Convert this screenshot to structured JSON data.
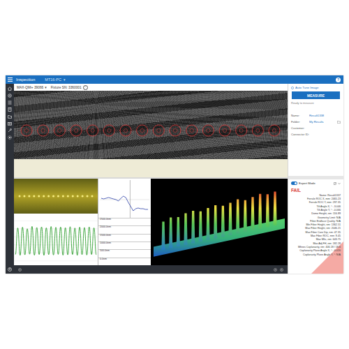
{
  "header": {
    "title": "Inspection",
    "tab": "MT16-PC",
    "tab_arrow": "▾",
    "help": "?"
  },
  "toolbar": {
    "device": "MAX-QMi+ 39066",
    "device_arrow": "▾",
    "fixture": "Fixture SN: 3360001",
    "info": "i"
  },
  "side": {
    "auto_tune": "Auto Tune Image",
    "measure": "MEASURE",
    "ready": "Ready to measure",
    "fields": [
      {
        "label": "Name:",
        "value": "Result1338",
        "kind": "link"
      },
      {
        "label": "Folder:",
        "value": "My Results",
        "kind": "folder"
      },
      {
        "label": "Customer:",
        "kind": "text"
      },
      {
        "label": "Connector ID:",
        "kind": "text"
      }
    ]
  },
  "result": {
    "expert_mode": {
      "label": "Expert Mode",
      "on": true
    },
    "status": "FAIL",
    "failed": true,
    "rows": [
      "Name: Result1337",
      "Ferrule ROC X, mm: 2465.23",
      "Ferrule ROC Y, mm: 297.35",
      "Tilt Angle X, °: -3.046",
      "Tilt Angle Y, °: -0.066",
      "Dome Height, nm: 116.89",
      "Geometry Limit: N/A",
      "Fiber Endface Quality: N/A",
      "Min Fiber Height, nm: 1362.51",
      "Max Fiber Height, nm: 2046.21",
      "Max Fiber Core Dip, nm: 47.35",
      "Max Fiber ROC, mm: 9.45",
      "Max Mfic, nm: 643.75",
      "Max Adj FH, nm: 182.28",
      "Mfines Coplanarity, nm: 406.18 / 18.6",
      "Coplanarity Plane Angle X, °: -0.020",
      "Coplanarity Plane Angle Y, °: N/A"
    ]
  },
  "profile_chart": {
    "ticks": [
      "2500.0nm",
      "2000.0nm",
      "1500.0nm",
      "1000.0nm",
      "500.0nm",
      "0.0nm"
    ],
    "values": [
      400,
      2050,
      350,
      2100,
      380,
      2000,
      420,
      2150,
      360,
      2080,
      400,
      2120,
      350,
      2060,
      390,
      2140,
      370,
      2090,
      410,
      2110,
      360,
      2070,
      380,
      2130,
      400,
      2050,
      350,
      2100,
      390,
      2080,
      370,
      2120,
      400,
      2060,
      380
    ]
  },
  "cross_section": {
    "values": [
      28,
      27,
      28,
      29,
      28,
      27,
      26,
      24,
      28,
      31,
      29,
      22,
      16,
      10,
      13,
      14,
      13,
      13,
      12,
      12
    ]
  },
  "height_map": {
    "values": [
      1650,
      1800,
      1720,
      1850,
      1900,
      1780,
      1880,
      1950,
      1820,
      1900,
      2010,
      1870,
      1960,
      2046,
      1930,
      1990
    ]
  }
}
